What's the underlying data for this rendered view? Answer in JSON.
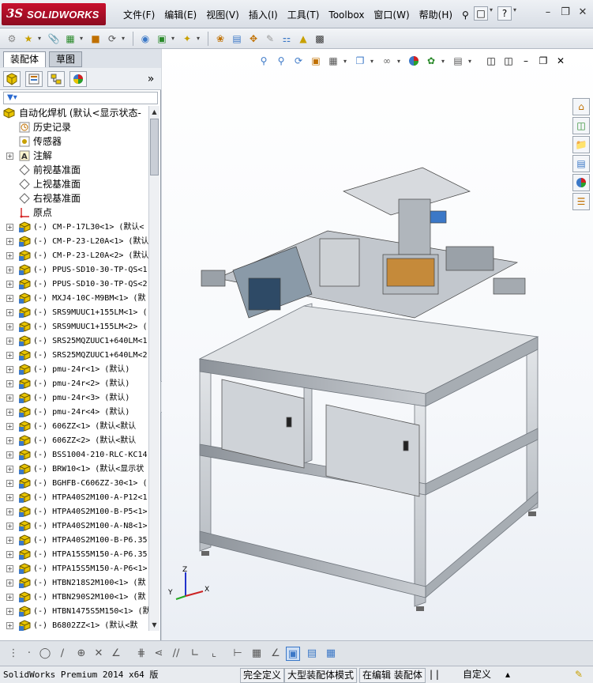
{
  "app": {
    "brand_ds": "3S",
    "brand": "SOLIDWORKS",
    "menus": [
      "文件(F)",
      "编辑(E)",
      "视图(V)",
      "插入(I)",
      "工具(T)",
      "Toolbox",
      "窗口(W)",
      "帮助(H)"
    ]
  },
  "panel": {
    "tabs": [
      "装配体",
      "草图"
    ],
    "tree": [
      {
        "type": "root",
        "label": "自动化焊机  (默认<显示状态-"
      },
      {
        "type": "feat",
        "icon": "history",
        "label": "历史记录"
      },
      {
        "type": "feat",
        "icon": "sensor",
        "label": "传感器"
      },
      {
        "type": "feat",
        "icon": "annotation",
        "label": "注解",
        "exp": true
      },
      {
        "type": "feat",
        "icon": "plane",
        "label": "前视基准面"
      },
      {
        "type": "feat",
        "icon": "plane",
        "label": "上视基准面"
      },
      {
        "type": "feat",
        "icon": "plane",
        "label": "右视基准面"
      },
      {
        "type": "feat",
        "icon": "origin",
        "label": "原点"
      },
      {
        "type": "part",
        "label": "(-) CM-P-17L30<1> (默认<"
      },
      {
        "type": "part",
        "label": "(-) CM-P-23-L20A<1> (默认"
      },
      {
        "type": "part",
        "label": "(-) CM-P-23-L20A<2> (默认"
      },
      {
        "type": "part",
        "label": "(-) PPUS-SD10-30-TP-QS<1"
      },
      {
        "type": "part",
        "label": "(-) PPUS-SD10-30-TP-QS<2"
      },
      {
        "type": "part",
        "label": "(-) MXJ4-10C-M9BM<1> (默"
      },
      {
        "type": "part",
        "label": "(-) SRS9MUUC1+155LM<1> ("
      },
      {
        "type": "part",
        "label": "(-) SRS9MUUC1+155LM<2> ("
      },
      {
        "type": "part",
        "label": "(-) SRS25MQZUUC1+640LM<1"
      },
      {
        "type": "part",
        "label": "(-) SRS25MQZUUC1+640LM<2"
      },
      {
        "type": "part",
        "label": "(-) pmu-24r<1> (默认)"
      },
      {
        "type": "part",
        "label": "(-) pmu-24r<2> (默认)"
      },
      {
        "type": "part",
        "label": "(-) pmu-24r<3> (默认)"
      },
      {
        "type": "part",
        "label": "(-) pmu-24r<4> (默认)"
      },
      {
        "type": "part",
        "label": "(-) 606ZZ<1> (默认<默认"
      },
      {
        "type": "part",
        "label": "(-) 606ZZ<2> (默认<默认"
      },
      {
        "type": "part",
        "label": "(-) BSS1004-210-RLC-KC14"
      },
      {
        "type": "part",
        "label": "(-) BRW10<1> (默认<显示状"
      },
      {
        "type": "part",
        "label": "(-) BGHFB-C606ZZ-30<1> ("
      },
      {
        "type": "part",
        "label": "(-) HTPA40S2M100-A-P12<1"
      },
      {
        "type": "part",
        "label": "(-) HTPA40S2M100-B-P5<1>"
      },
      {
        "type": "part",
        "label": "(-) HTPA40S2M100-A-N8<1>"
      },
      {
        "type": "part",
        "label": "(-) HTPA40S2M100-B-P6.35"
      },
      {
        "type": "part",
        "label": "(-) HTPA15S5M150-A-P6.35"
      },
      {
        "type": "part",
        "label": "(-) HTPA15S5M150-A-P6<1>"
      },
      {
        "type": "part",
        "label": "(-) HTBN218S2M100<1> (默"
      },
      {
        "type": "part",
        "label": "(-) HTBN290S2M100<1> (默"
      },
      {
        "type": "part",
        "label": "(-) HTBN1475S5M150<1> (默"
      },
      {
        "type": "part",
        "label": "(-) B6802ZZ<1> (默认<默"
      }
    ]
  },
  "triad": {
    "x": "X",
    "y": "Y",
    "z": "Z"
  },
  "status": {
    "version": "SolidWorks Premium 2014 x64 版",
    "fully_defined": "完全定义",
    "large_mode": "大型装配体模式",
    "editing": "在编辑 装配体",
    "units": "自定义"
  },
  "colors": {
    "accent": "#c8102e",
    "frame": "#b9bec4",
    "selection": "#3b78c7"
  }
}
